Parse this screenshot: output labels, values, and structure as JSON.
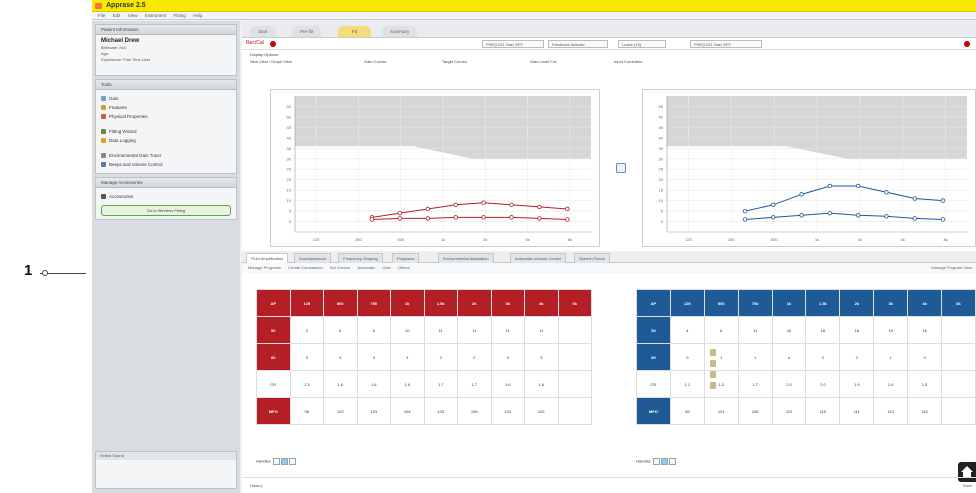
{
  "callout": {
    "number": "1"
  },
  "app": {
    "title": "Apprase 2.5"
  },
  "menu": [
    "File",
    "Edit",
    "View",
    "Instrument",
    "Fitting",
    "Help"
  ],
  "patient": {
    "section_label": "Patient Information",
    "name": "Michael Drew",
    "lines": [
      "Birthdate: N/A",
      "Age:",
      "Experience: First Time User"
    ]
  },
  "tools": {
    "section_label": "Tools",
    "group1": [
      {
        "label": "Gain",
        "icon": "gain-icon"
      },
      {
        "label": "Features",
        "icon": "features-icon"
      },
      {
        "label": "Physical Properties",
        "icon": "physical-properties-icon"
      }
    ],
    "group2": [
      {
        "label": "Fitting Wizard",
        "icon": "fitting-wizard-icon"
      },
      {
        "label": "Data Logging",
        "icon": "data-logging-icon"
      }
    ],
    "group3": [
      {
        "label": "Environmental Gain Tuner",
        "icon": "gain-tuner-icon"
      },
      {
        "label": "Beeps and Volume Control",
        "icon": "beeps-volume-icon"
      }
    ]
  },
  "accessories": {
    "section_label": "Manage Accessories",
    "item": "Accessories",
    "button": "Go to Wireless Fitting"
  },
  "lower_panel": {
    "label": "Select Sound"
  },
  "tabs": [
    "Start",
    "Pre-fitt",
    "Fit",
    "Summary"
  ],
  "toolbar": {
    "record_label": "Rec/Cal",
    "field1": "FREQ DO Gain OFF",
    "field2": "Feedback Activate",
    "field3": "Leave (10)",
    "field4": "FREQ DO Gain OFF"
  },
  "display": {
    "label": "Display Options",
    "view_options": "New View / Graph View",
    "gain_curves": "Gain Curves",
    "target_curves": "Target Curves",
    "gain_level_for": "Gain Level For:",
    "input_correction": "Input Correction"
  },
  "lower_tabs": [
    "Fluid Amplification",
    "Soundpressure",
    "Frequency Shaping",
    "Programs",
    "Environmental Adaptation",
    "Automatic Volume Control",
    "Speech Focus"
  ],
  "sublinks": [
    "Manage Programs",
    "Create Comparison",
    "Set Volume",
    "Automatic",
    "Gain",
    "Others"
  ],
  "manage_program_view": "Manage Program View",
  "colors": {
    "left_ear": "#b41f26",
    "right_ear": "#1e5a96",
    "title_bar": "#f7e800",
    "active_tab": "#f3dd78",
    "fit_button_border": "#5aa840"
  },
  "chart_data": [
    {
      "type": "line",
      "title": "",
      "x": [
        "125",
        "250",
        "500",
        "1k",
        "2k",
        "4k",
        "8k"
      ],
      "ylim": [
        -5,
        60
      ],
      "yticks": [
        0,
        5,
        10,
        15,
        20,
        25,
        30,
        35,
        40,
        45,
        50,
        55
      ],
      "series": [
        {
          "values": [
            2,
            4,
            6,
            8,
            9,
            8,
            7,
            6
          ]
        },
        {
          "values": [
            1,
            1.5,
            1.5,
            2,
            2,
            2,
            1.5,
            1
          ]
        }
      ]
    },
    {
      "type": "line",
      "title": "",
      "x": [
        "125",
        "250",
        "500",
        "1k",
        "2k",
        "4k",
        "8k"
      ],
      "ylim": [
        -5,
        60
      ],
      "yticks": [
        0,
        5,
        10,
        15,
        20,
        25,
        30,
        35,
        40,
        45,
        50,
        55
      ],
      "series": [
        {
          "values": [
            5,
            8,
            13,
            17,
            17,
            14,
            11,
            10
          ]
        },
        {
          "values": [
            1,
            2,
            3,
            4,
            3,
            2.5,
            1.5,
            1
          ]
        }
      ]
    }
  ],
  "left_table": {
    "header": [
      "AP",
      "125",
      "500",
      "750",
      "1k",
      "1.5k",
      "2k",
      "3k",
      "4k",
      "6k"
    ],
    "rows": [
      {
        "label": "50",
        "cells": [
          "3",
          "6",
          "8",
          "10",
          "11",
          "11",
          "11",
          "11"
        ]
      },
      {
        "label": "80",
        "cells": [
          "3",
          "3",
          "3",
          "3",
          "2",
          "2",
          "3",
          "3"
        ]
      },
      {
        "label": "CR",
        "cells": [
          "1.3",
          "1.6",
          "1.6",
          "1.6",
          "1.7",
          "1.7",
          "1.6",
          "1.6"
        ]
      },
      {
        "label": "MPO",
        "cells": [
          "96",
          "100",
          "103",
          "104",
          "103",
          "106",
          "102",
          "102"
        ]
      }
    ]
  },
  "right_table": {
    "header": [
      "AP",
      "125",
      "500",
      "750",
      "1k",
      "1.5k",
      "2k",
      "3k",
      "4k",
      "6k"
    ],
    "rows": [
      {
        "label": "50",
        "cells": [
          "4",
          "8",
          "11",
          "16",
          "16",
          "16",
          "15",
          "16"
        ]
      },
      {
        "label": "80",
        "cells": [
          "0",
          "1",
          "1",
          "4",
          "2",
          "2",
          "1",
          "0"
        ]
      },
      {
        "label": "CR",
        "cells": [
          "1.1",
          "1.3",
          "1.7",
          "2.0",
          "2.0",
          "1.9",
          "1.6",
          "1.5"
        ]
      },
      {
        "label": "MPO",
        "cells": [
          "95",
          "101",
          "106",
          "110",
          "110",
          "111",
          "110",
          "110"
        ]
      }
    ]
  },
  "handles": {
    "label": "Handles",
    "options": [
      "1",
      "2",
      "3"
    ]
  },
  "footer": {
    "left": "History",
    "right": "Save"
  }
}
